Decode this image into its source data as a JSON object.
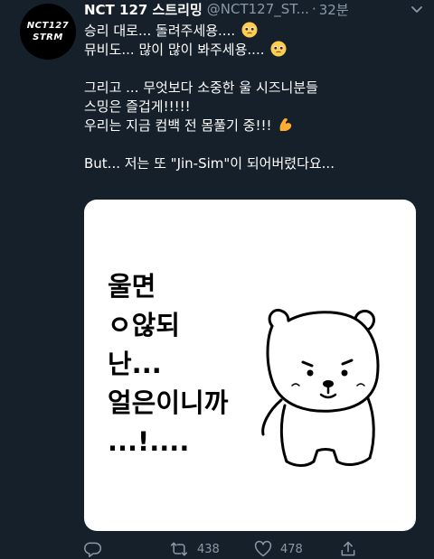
{
  "avatar": {
    "line1": "NCT127",
    "line2": "STRM"
  },
  "header": {
    "display_name": "NCT 127 스트리밍",
    "handle": "@NCT127_ST...",
    "separator": "·",
    "time": "32분"
  },
  "tweet": {
    "lines": [
      "승리 대로... 돌려주세용....",
      "뮤비도... 많이 많이 봐주세용....",
      "그리고 ... 무엇보다 소중한 울 시즈니분들",
      "스밍은 즐겁게!!!!!",
      "우리는 지금 컴백 전 몸풀기 중!!!",
      "But... 저는 또 \"Jin-Sim\"이 되어버렸다요..."
    ],
    "emojis": [
      "pleading-face-emoji",
      "pleading-face-emoji",
      "flexed-biceps-emoji"
    ]
  },
  "media": {
    "meme_lines": [
      "울면",
      "ㅇ않되",
      "난...",
      "얼은이니까",
      "...!...."
    ]
  },
  "actions": {
    "reply_icon": "reply-icon",
    "retweet_icon": "retweet-icon",
    "retweet_count": "438",
    "like_icon": "heart-icon",
    "like_count": "478",
    "share_icon": "share-icon"
  },
  "colors": {
    "background": "#15202b",
    "text": "#ffffff",
    "secondary": "#8b98a5"
  }
}
